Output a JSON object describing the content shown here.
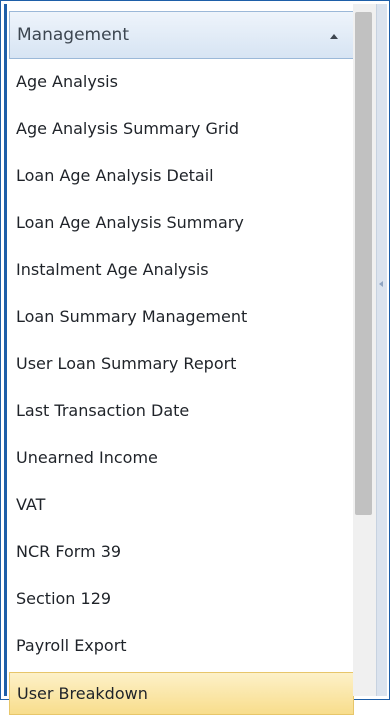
{
  "section": {
    "title": "Management",
    "toggle_icon": "chevron-up-icon"
  },
  "menu": {
    "items": [
      "Age Analysis",
      "Age Analysis Summary Grid",
      "Loan Age Analysis Detail",
      "Loan Age Analysis Summary",
      "Instalment Age Analysis",
      "Loan Summary Management",
      "User Loan Summary Report",
      "Last Transaction Date",
      "Unearned Income",
      "VAT",
      "NCR Form 39",
      "Section 129",
      "Payroll Export",
      "User Breakdown"
    ],
    "selected": "User Breakdown"
  },
  "colors": {
    "header_bg": "#dbe6f4",
    "selected_bg": "#fbe6a6",
    "border": "#1e5fa8"
  },
  "splitter": {
    "icon": "chevron-left-icon"
  }
}
